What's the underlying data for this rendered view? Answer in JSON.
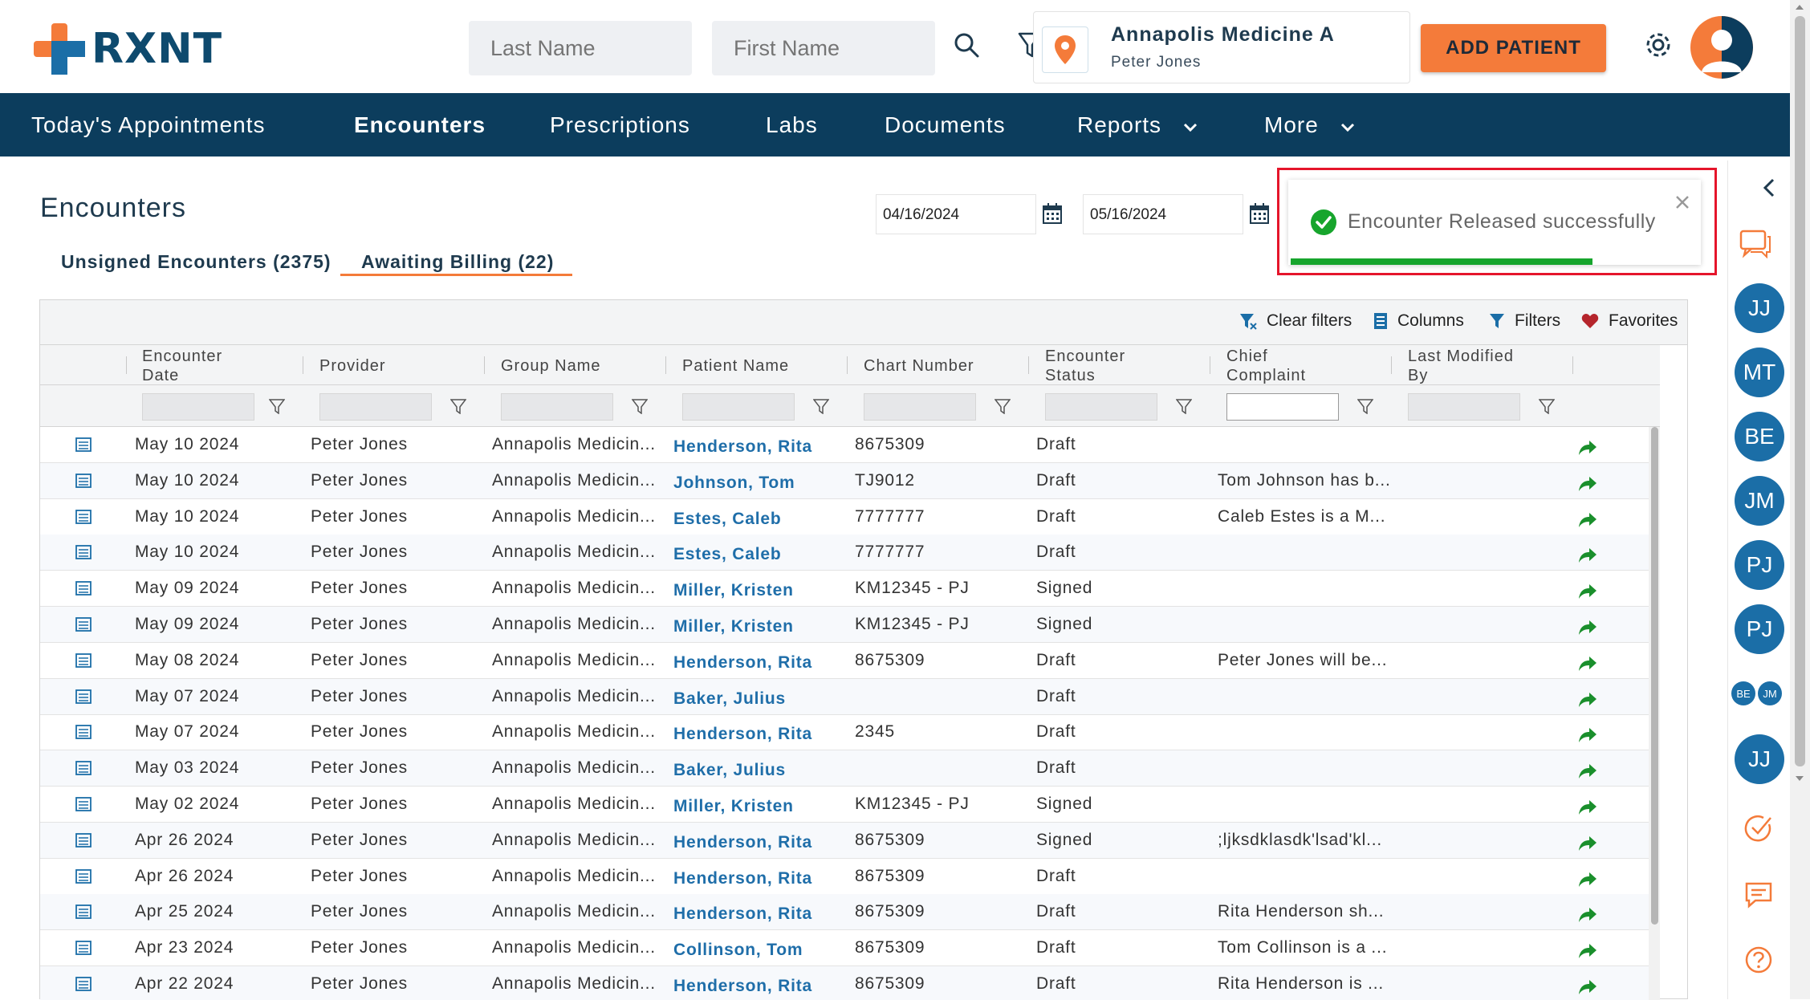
{
  "header": {
    "logo_text": "RXNT",
    "last_name_placeholder": "Last Name",
    "first_name_placeholder": "First Name",
    "location_name": "Annapolis Medicine A",
    "location_user": "Peter Jones",
    "add_patient_label": "ADD PATIENT",
    "brand_color": "#f47b3a",
    "nav_color": "#0c3d5d"
  },
  "nav": {
    "items": [
      {
        "label": "Today's Appointments"
      },
      {
        "label": "Encounters"
      },
      {
        "label": "Prescriptions"
      },
      {
        "label": "Labs"
      },
      {
        "label": "Documents"
      },
      {
        "label": "Reports"
      },
      {
        "label": "More"
      }
    ]
  },
  "page": {
    "title": "Encounters",
    "tabs": [
      {
        "label": "Unsigned Encounters (2375)"
      },
      {
        "label": "Awaiting Billing (22)"
      }
    ],
    "start_date": "04/16/2024",
    "end_date": "05/16/2024"
  },
  "toast": {
    "message": "Encounter Released successfully",
    "progress": 0.74
  },
  "toolbar": {
    "clear_filters": "Clear filters",
    "columns": "Columns",
    "filters": "Filters",
    "favorites": "Favorites"
  },
  "columns": [
    {
      "label": "Encounter Date"
    },
    {
      "label": "Provider"
    },
    {
      "label": "Group Name"
    },
    {
      "label": "Patient Name"
    },
    {
      "label": "Chart Number"
    },
    {
      "label": "Encounter Status"
    },
    {
      "label": "Chief Complaint"
    },
    {
      "label": "Last Modified By"
    }
  ],
  "rows": [
    {
      "date": "May 10 2024",
      "provider": "Peter Jones",
      "group": "Annapolis Medicin...",
      "patient": "Henderson, Rita",
      "chart": "8675309",
      "status": "Draft",
      "complaint": ""
    },
    {
      "date": "May 10 2024",
      "provider": "Peter Jones",
      "group": "Annapolis Medicin...",
      "patient": "Johnson, Tom",
      "chart": "TJ9012",
      "status": "Draft",
      "complaint": "Tom Johnson has b..."
    },
    {
      "date": "May 10 2024",
      "provider": "Peter Jones",
      "group": "Annapolis Medicin...",
      "patient": "Estes, Caleb",
      "chart": "7777777",
      "status": "Draft",
      "complaint": "Caleb Estes is a M..."
    },
    {
      "date": "May 10 2024",
      "provider": "Peter Jones",
      "group": "Annapolis Medicin...",
      "patient": "Estes, Caleb",
      "chart": "7777777",
      "status": "Draft",
      "complaint": ""
    },
    {
      "date": "May 09 2024",
      "provider": "Peter Jones",
      "group": "Annapolis Medicin...",
      "patient": "Miller, Kristen",
      "chart": "KM12345 - PJ",
      "status": "Signed",
      "complaint": ""
    },
    {
      "date": "May 09 2024",
      "provider": "Peter Jones",
      "group": "Annapolis Medicin...",
      "patient": "Miller, Kristen",
      "chart": "KM12345 - PJ",
      "status": "Signed",
      "complaint": ""
    },
    {
      "date": "May 08 2024",
      "provider": "Peter Jones",
      "group": "Annapolis Medicin...",
      "patient": "Henderson, Rita",
      "chart": "8675309",
      "status": "Draft",
      "complaint": "Peter Jones will be..."
    },
    {
      "date": "May 07 2024",
      "provider": "Peter Jones",
      "group": "Annapolis Medicin...",
      "patient": "Baker, Julius",
      "chart": "",
      "status": "Draft",
      "complaint": ""
    },
    {
      "date": "May 07 2024",
      "provider": "Peter Jones",
      "group": "Annapolis Medicin...",
      "patient": "Henderson, Rita",
      "chart": "2345",
      "status": "Draft",
      "complaint": ""
    },
    {
      "date": "May 03 2024",
      "provider": "Peter Jones",
      "group": "Annapolis Medicin...",
      "patient": "Baker, Julius",
      "chart": "",
      "status": "Draft",
      "complaint": ""
    },
    {
      "date": "May 02 2024",
      "provider": "Peter Jones",
      "group": "Annapolis Medicin...",
      "patient": "Miller, Kristen",
      "chart": "KM12345 - PJ",
      "status": "Signed",
      "complaint": ""
    },
    {
      "date": "Apr 26 2024",
      "provider": "Peter Jones",
      "group": "Annapolis Medicin...",
      "patient": "Henderson, Rita",
      "chart": "8675309",
      "status": "Signed",
      "complaint": ";ljksdklasdk'lsad'kl..."
    },
    {
      "date": "Apr 26 2024",
      "provider": "Peter Jones",
      "group": "Annapolis Medicin...",
      "patient": "Henderson, Rita",
      "chart": "8675309",
      "status": "Draft",
      "complaint": ""
    },
    {
      "date": "Apr 25 2024",
      "provider": "Peter Jones",
      "group": "Annapolis Medicin...",
      "patient": "Henderson, Rita",
      "chart": "8675309",
      "status": "Draft",
      "complaint": "Rita Henderson sh..."
    },
    {
      "date": "Apr 23 2024",
      "provider": "Peter Jones",
      "group": "Annapolis Medicin...",
      "patient": "Collinson, Tom",
      "chart": "8675309",
      "status": "Draft",
      "complaint": "Tom Collinson is a ..."
    },
    {
      "date": "Apr 22 2024",
      "provider": "Peter Jones",
      "group": "Annapolis Medicin...",
      "patient": "Henderson, Rita",
      "chart": "8675309",
      "status": "Draft",
      "complaint": "Rita Henderson is ..."
    }
  ],
  "rail": {
    "avatars": [
      "JJ",
      "MT",
      "BE",
      "JM",
      "PJ",
      "PJ"
    ],
    "small_avatars": [
      "BE",
      "JM"
    ],
    "last_avatar": "JJ"
  }
}
